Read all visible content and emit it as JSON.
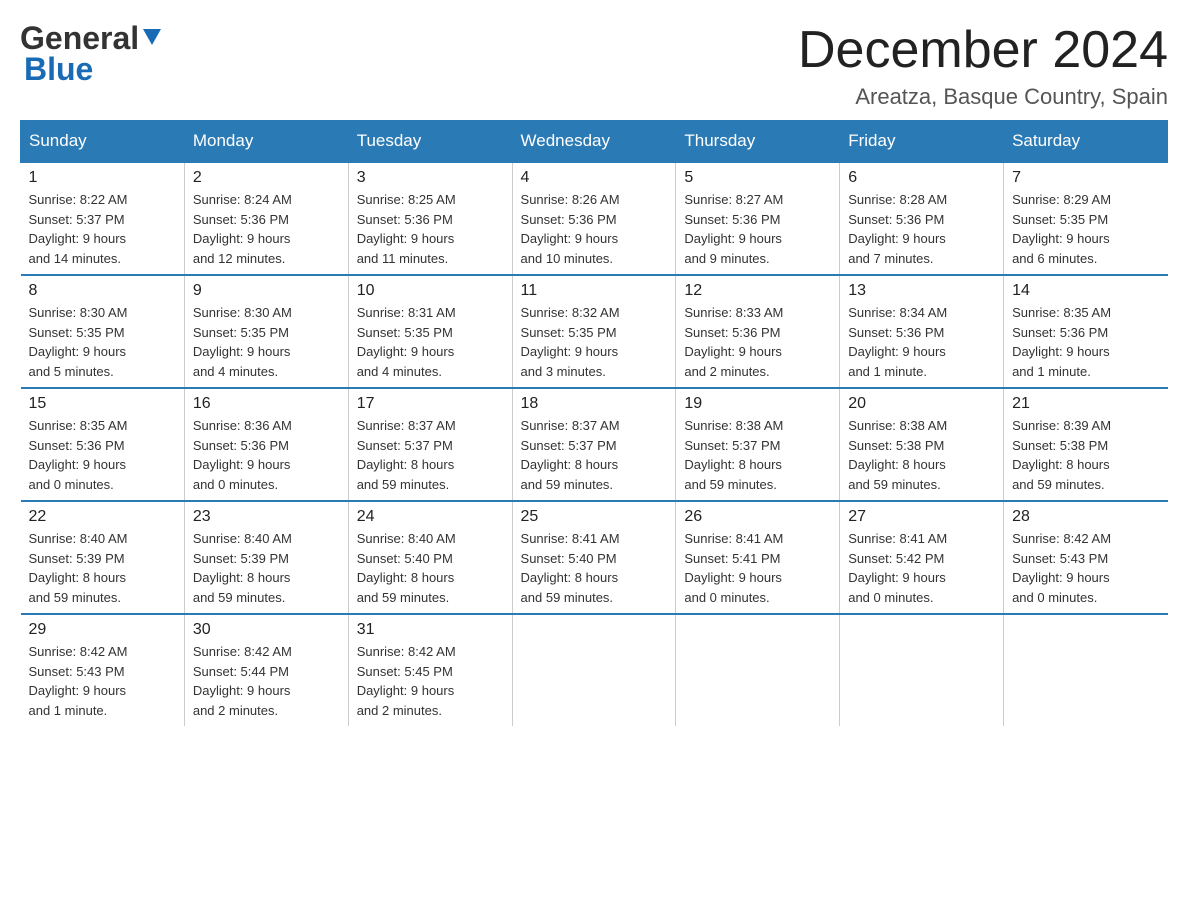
{
  "logo": {
    "general": "General",
    "blue": "Blue"
  },
  "title": {
    "month_year": "December 2024",
    "location": "Areatza, Basque Country, Spain"
  },
  "weekdays": [
    "Sunday",
    "Monday",
    "Tuesday",
    "Wednesday",
    "Thursday",
    "Friday",
    "Saturday"
  ],
  "weeks": [
    [
      {
        "day": "1",
        "sunrise": "8:22 AM",
        "sunset": "5:37 PM",
        "daylight": "9 hours and 14 minutes."
      },
      {
        "day": "2",
        "sunrise": "8:24 AM",
        "sunset": "5:36 PM",
        "daylight": "9 hours and 12 minutes."
      },
      {
        "day": "3",
        "sunrise": "8:25 AM",
        "sunset": "5:36 PM",
        "daylight": "9 hours and 11 minutes."
      },
      {
        "day": "4",
        "sunrise": "8:26 AM",
        "sunset": "5:36 PM",
        "daylight": "9 hours and 10 minutes."
      },
      {
        "day": "5",
        "sunrise": "8:27 AM",
        "sunset": "5:36 PM",
        "daylight": "9 hours and 9 minutes."
      },
      {
        "day": "6",
        "sunrise": "8:28 AM",
        "sunset": "5:36 PM",
        "daylight": "9 hours and 7 minutes."
      },
      {
        "day": "7",
        "sunrise": "8:29 AM",
        "sunset": "5:35 PM",
        "daylight": "9 hours and 6 minutes."
      }
    ],
    [
      {
        "day": "8",
        "sunrise": "8:30 AM",
        "sunset": "5:35 PM",
        "daylight": "9 hours and 5 minutes."
      },
      {
        "day": "9",
        "sunrise": "8:30 AM",
        "sunset": "5:35 PM",
        "daylight": "9 hours and 4 minutes."
      },
      {
        "day": "10",
        "sunrise": "8:31 AM",
        "sunset": "5:35 PM",
        "daylight": "9 hours and 4 minutes."
      },
      {
        "day": "11",
        "sunrise": "8:32 AM",
        "sunset": "5:35 PM",
        "daylight": "9 hours and 3 minutes."
      },
      {
        "day": "12",
        "sunrise": "8:33 AM",
        "sunset": "5:36 PM",
        "daylight": "9 hours and 2 minutes."
      },
      {
        "day": "13",
        "sunrise": "8:34 AM",
        "sunset": "5:36 PM",
        "daylight": "9 hours and 1 minute."
      },
      {
        "day": "14",
        "sunrise": "8:35 AM",
        "sunset": "5:36 PM",
        "daylight": "9 hours and 1 minute."
      }
    ],
    [
      {
        "day": "15",
        "sunrise": "8:35 AM",
        "sunset": "5:36 PM",
        "daylight": "9 hours and 0 minutes."
      },
      {
        "day": "16",
        "sunrise": "8:36 AM",
        "sunset": "5:36 PM",
        "daylight": "9 hours and 0 minutes."
      },
      {
        "day": "17",
        "sunrise": "8:37 AM",
        "sunset": "5:37 PM",
        "daylight": "8 hours and 59 minutes."
      },
      {
        "day": "18",
        "sunrise": "8:37 AM",
        "sunset": "5:37 PM",
        "daylight": "8 hours and 59 minutes."
      },
      {
        "day": "19",
        "sunrise": "8:38 AM",
        "sunset": "5:37 PM",
        "daylight": "8 hours and 59 minutes."
      },
      {
        "day": "20",
        "sunrise": "8:38 AM",
        "sunset": "5:38 PM",
        "daylight": "8 hours and 59 minutes."
      },
      {
        "day": "21",
        "sunrise": "8:39 AM",
        "sunset": "5:38 PM",
        "daylight": "8 hours and 59 minutes."
      }
    ],
    [
      {
        "day": "22",
        "sunrise": "8:40 AM",
        "sunset": "5:39 PM",
        "daylight": "8 hours and 59 minutes."
      },
      {
        "day": "23",
        "sunrise": "8:40 AM",
        "sunset": "5:39 PM",
        "daylight": "8 hours and 59 minutes."
      },
      {
        "day": "24",
        "sunrise": "8:40 AM",
        "sunset": "5:40 PM",
        "daylight": "8 hours and 59 minutes."
      },
      {
        "day": "25",
        "sunrise": "8:41 AM",
        "sunset": "5:40 PM",
        "daylight": "8 hours and 59 minutes."
      },
      {
        "day": "26",
        "sunrise": "8:41 AM",
        "sunset": "5:41 PM",
        "daylight": "9 hours and 0 minutes."
      },
      {
        "day": "27",
        "sunrise": "8:41 AM",
        "sunset": "5:42 PM",
        "daylight": "9 hours and 0 minutes."
      },
      {
        "day": "28",
        "sunrise": "8:42 AM",
        "sunset": "5:43 PM",
        "daylight": "9 hours and 0 minutes."
      }
    ],
    [
      {
        "day": "29",
        "sunrise": "8:42 AM",
        "sunset": "5:43 PM",
        "daylight": "9 hours and 1 minute."
      },
      {
        "day": "30",
        "sunrise": "8:42 AM",
        "sunset": "5:44 PM",
        "daylight": "9 hours and 2 minutes."
      },
      {
        "day": "31",
        "sunrise": "8:42 AM",
        "sunset": "5:45 PM",
        "daylight": "9 hours and 2 minutes."
      },
      null,
      null,
      null,
      null
    ]
  ],
  "labels": {
    "sunrise": "Sunrise:",
    "sunset": "Sunset:",
    "daylight": "Daylight:"
  }
}
